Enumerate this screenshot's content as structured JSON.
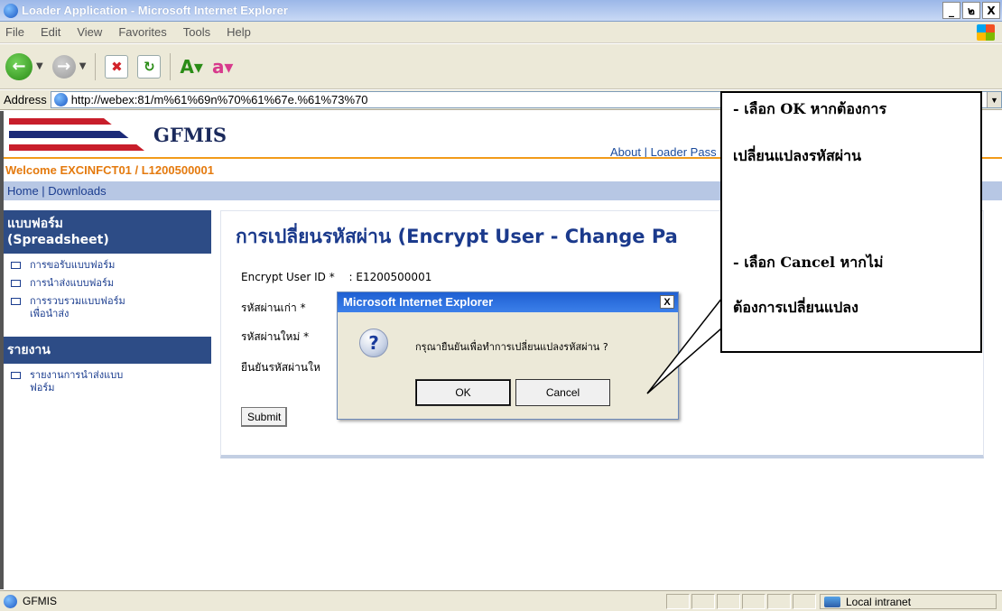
{
  "window": {
    "title": "Loader Application - Microsoft Internet Explorer",
    "min_label": "_",
    "max_label": "๒",
    "close_label": "X"
  },
  "menu": {
    "items": [
      "File",
      "Edit",
      "View",
      "Favorites",
      "Tools",
      "Help"
    ]
  },
  "address": {
    "label": "Address",
    "url": "http://webex:81/m%61%69n%70%61%67e.%61%73%70"
  },
  "site": {
    "brand": "GFMIS",
    "top_links": "About | Loader Pass",
    "welcome": "Welcome EXCINFCT01 / L1200500001",
    "nav": "Home | Downloads"
  },
  "sidebar": {
    "section1_title_line1": "แบบฟอร์ม",
    "section1_title_line2": "(Spreadsheet)",
    "section1_items": [
      "การขอรับแบบฟอร์ม",
      "การนำส่งแบบฟอร์ม",
      "การรวบรวมแบบฟอร์มเพื่อนำส่ง"
    ],
    "section2_title": "รายงาน",
    "section2_items": [
      "รายงานการนำส่งแบบฟอร์ม"
    ]
  },
  "main": {
    "title": "การเปลี่ยนรหัสผ่าน (Encrypt User - Change Pa",
    "user_id_label": "Encrypt User ID *",
    "user_id_value": ": E1200500001",
    "old_pw_label": "รหัสผ่านเก่า *",
    "new_pw_label": "รหัสผ่านใหม่ *",
    "confirm_pw_label": "ยืนยันรหัสผ่านให",
    "submit_label": "Submit"
  },
  "dialog": {
    "title": "Microsoft Internet Explorer",
    "close_label": "X",
    "message": "กรุณายืนยันเพื่อทำการเปลี่ยนแปลงรหัสผ่าน ?",
    "ok_label": "OK",
    "cancel_label": "Cancel"
  },
  "callout": {
    "line1": "- เลือก OK หากต้องการ",
    "line2": "เปลี่ยนแปลงรหัสผ่าน",
    "line3": "- เลือก Cancel หากไม่",
    "line4": "ต้องการเปลี่ยนแปลง"
  },
  "status": {
    "text": "GFMIS",
    "zone": "Local intranet"
  }
}
